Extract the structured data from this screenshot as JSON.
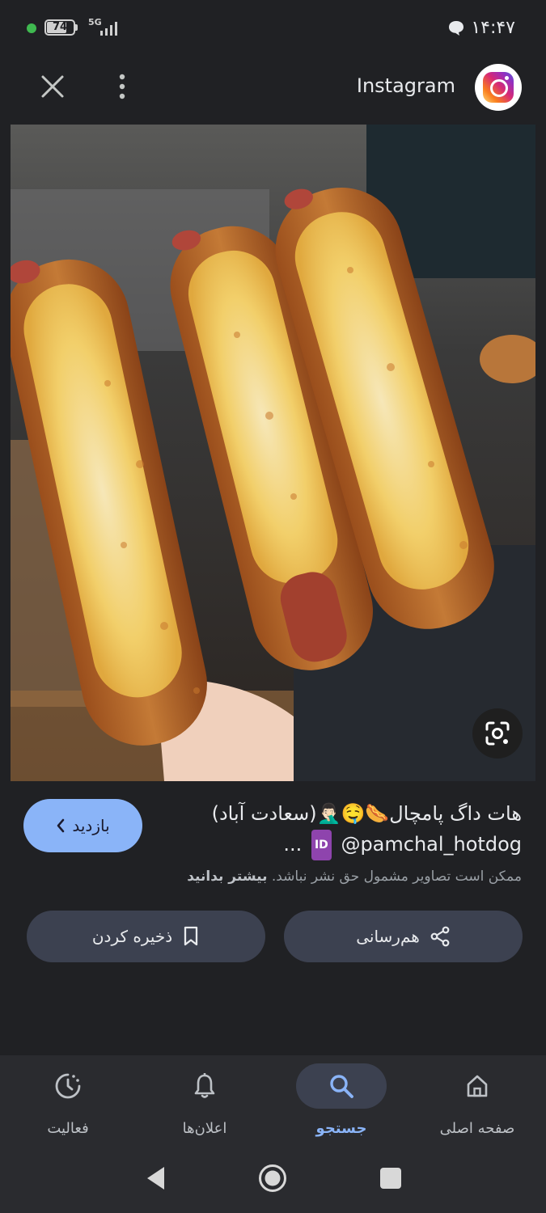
{
  "status_bar": {
    "battery": "74",
    "battery_level": 0.74,
    "network": "5G",
    "time": "۱۴:۴۷"
  },
  "header": {
    "title": "Instagram",
    "icons": [
      "close-icon",
      "more-vert-icon",
      "instagram-logo"
    ]
  },
  "image": {
    "alt": "",
    "lens_icon": "google-lens-icon"
  },
  "caption": {
    "line1": "هات داگ پامچال🌭🤤🤦🏻‍♂️(سعادت آباد)",
    "line2_handle": "@pamchal_hotdog",
    "line2_badge": "ID",
    "line2_suffix": "...",
    "copyright_text": "ممکن است تصاویر مشمول حق نشر نباشد.",
    "learn_more": "بیشتر بدانید"
  },
  "visit_button": {
    "label": "بازدید"
  },
  "actions": {
    "share_label": "هم‌رسانی",
    "save_label": "ذخیره کردن"
  },
  "bottom_nav": {
    "items": [
      {
        "label": "صفحه اصلی",
        "icon": "home-icon",
        "active": false
      },
      {
        "label": "جستجو",
        "icon": "search-icon",
        "active": true
      },
      {
        "label": "اعلان‌ها",
        "icon": "bell-icon",
        "active": false
      },
      {
        "label": "فعالیت",
        "icon": "activity-icon",
        "active": false
      }
    ]
  },
  "colors": {
    "background": "#202124",
    "accent": "#8ab4f8",
    "button_bg": "#3c4150"
  }
}
